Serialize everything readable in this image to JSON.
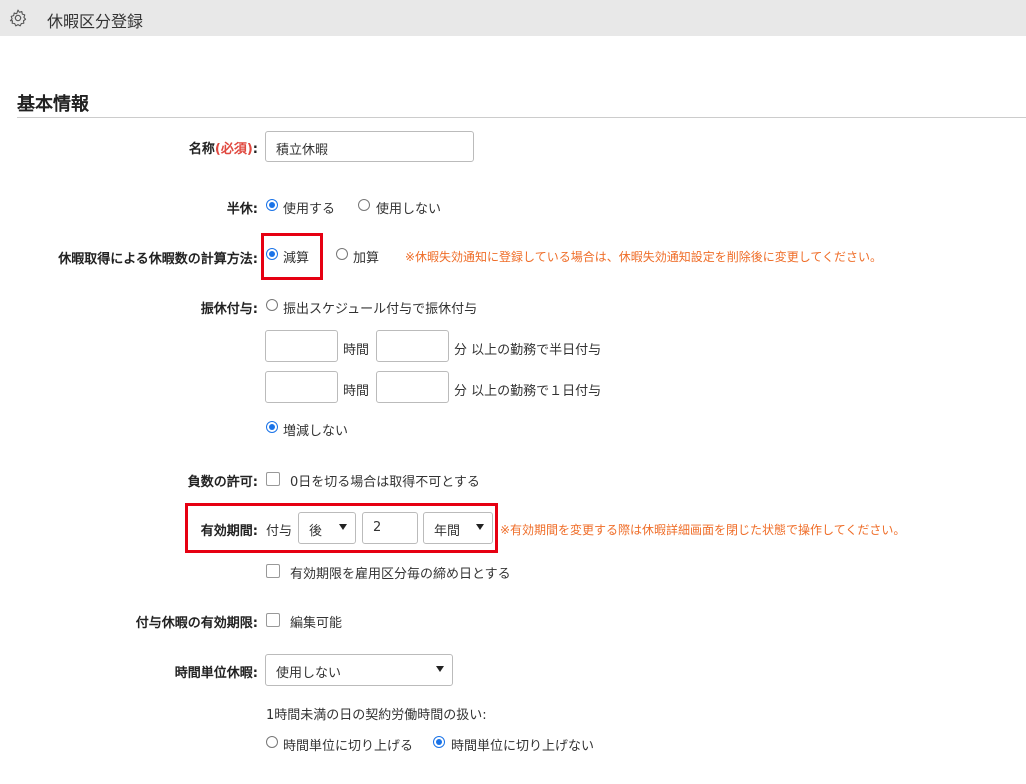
{
  "window": {
    "title": "休暇区分登録",
    "icon": "gear-icon"
  },
  "section": {
    "title": "基本情報"
  },
  "name_field": {
    "label": "名称",
    "required": "(必須)",
    "colon": ":",
    "value": "積立休暇"
  },
  "half_day": {
    "label": "半休:",
    "options": [
      "使用する",
      "使用しない"
    ],
    "selected": 0
  },
  "calc_method": {
    "label": "休暇取得による休暇数の計算方法:",
    "options": [
      "減算",
      "加算"
    ],
    "selected": 0,
    "warning": "※休暇失効通知に登録している場合は、休暇失効通知設定を削除後に変更してください。"
  },
  "substitute": {
    "label": "振休付与:",
    "option_schedule": "振出スケジュール付与で振休付与",
    "hour_unit": "時間",
    "half_suffix": "分 以上の勤務で半日付与",
    "full_suffix": "分 以上の勤務で１日付与",
    "option_none": "増減しない",
    "selected": "none"
  },
  "negative": {
    "label": "負数の許可:",
    "checkbox_label": "0日を切る場合は取得不可とする",
    "checked": false
  },
  "validity": {
    "label": "有効期間:",
    "prefix": "付与",
    "direction": "後",
    "amount": "2",
    "unit": "年間",
    "warning": "※有効期間を変更する際は休暇詳細画面を閉じた状態で操作してください。",
    "closing_checkbox": "有効期限を雇用区分毎の締め日とする",
    "closing_checked": false
  },
  "granted_validity": {
    "label": "付与休暇の有効期限:",
    "checkbox_label": "編集可能",
    "checked": false
  },
  "hourly": {
    "label": "時間単位休暇:",
    "value": "使用しない",
    "note": "1時間未満の日の契約労働時間の扱い:",
    "options": [
      "時間単位に切り上げる",
      "時間単位に切り上げない"
    ],
    "selected": 1
  },
  "colors": {
    "accent": "#1a73e8",
    "warning": "#ef6d28",
    "highlight": "#e60012",
    "required": "#e0483f"
  }
}
